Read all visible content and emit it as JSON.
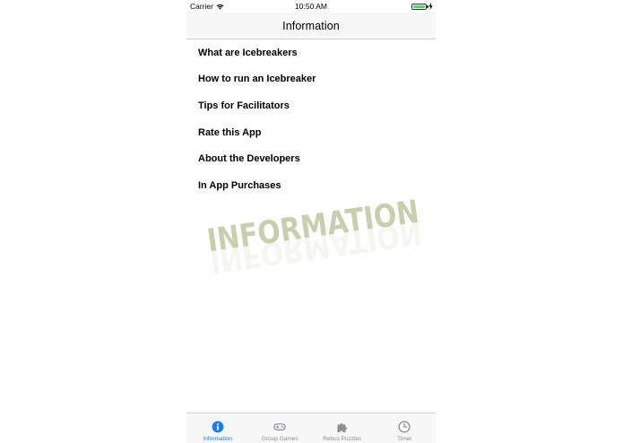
{
  "status_bar": {
    "carrier": "Carrier",
    "time": "10:50 AM",
    "battery_level": 1.0,
    "battery_color": "#4cd964"
  },
  "nav": {
    "title": "Information"
  },
  "menu": {
    "items": [
      {
        "label": "What are Icebreakers"
      },
      {
        "label": "How to run an Icebreaker"
      },
      {
        "label": "Tips for Facilitators"
      },
      {
        "label": "Rate this App"
      },
      {
        "label": "About the Developers"
      },
      {
        "label": "In App Purchases"
      }
    ]
  },
  "banner": {
    "text": "INFORMATION",
    "color": "#c9cfac"
  },
  "tab_bar": {
    "active_color": "#147efb",
    "inactive_color": "#8e8e93",
    "tabs": [
      {
        "label": "Information",
        "icon": "info-icon",
        "active": true
      },
      {
        "label": "Group Games",
        "icon": "gamepad-icon",
        "active": false
      },
      {
        "label": "Rebus Puzzles",
        "icon": "puzzle-icon",
        "active": false
      },
      {
        "label": "Timer",
        "icon": "clock-icon",
        "active": false
      }
    ]
  }
}
